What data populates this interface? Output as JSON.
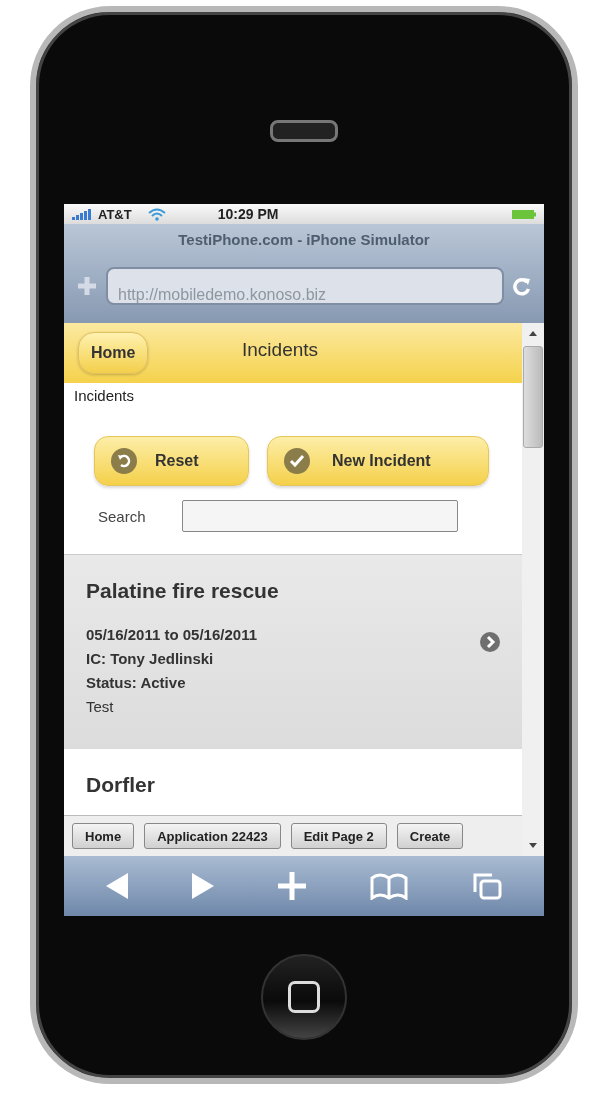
{
  "status_bar": {
    "carrier": "AT&T",
    "time": "10:29 PM"
  },
  "browser": {
    "title": "TestiPhone.com - iPhone Simulator",
    "url": "http://mobiledemo.konoso.biz"
  },
  "page": {
    "home_button": "Home",
    "title": "Incidents",
    "breadcrumb": "Incidents",
    "buttons": [
      {
        "label": "Reset",
        "kind": "reset"
      },
      {
        "label": "New Incident",
        "kind": "add"
      }
    ],
    "search": {
      "label": "Search"
    },
    "incidents": [
      {
        "title": "Palatine fire rescue",
        "dates": "05/16/2011 to 05/16/2011",
        "ic": "IC: Tony Jedlinski",
        "status": "Status: Active",
        "note": "Test",
        "selected": true
      },
      {
        "title": "Dorfler",
        "selected": false
      }
    ]
  },
  "toolbar": [
    "Home",
    "Application 22423",
    "Edit Page 2",
    "Create"
  ]
}
